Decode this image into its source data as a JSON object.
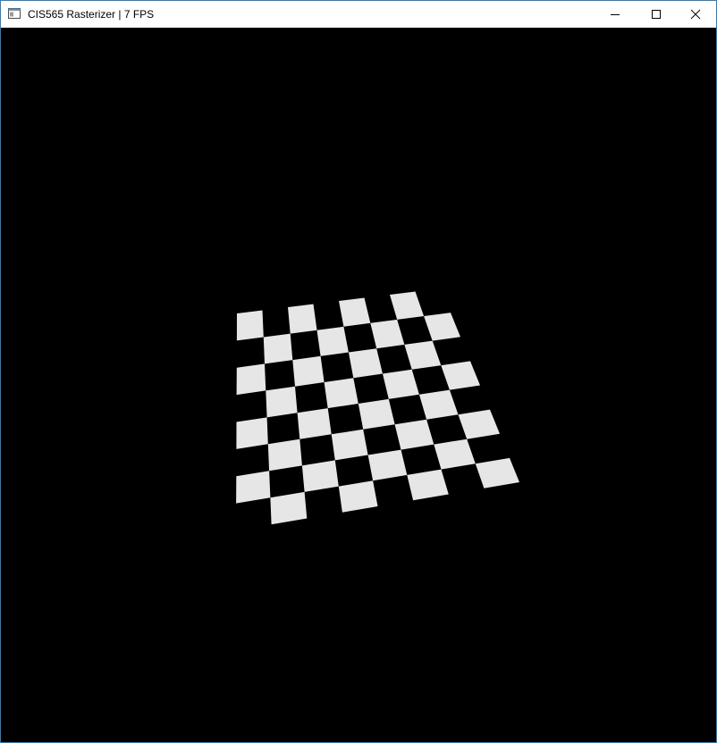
{
  "window": {
    "title": "CIS565 Rasterizer | 7 FPS",
    "icon": "app-window-icon",
    "controls": {
      "minimize": "minimize-icon",
      "maximize": "maximize-icon",
      "close": "close-icon"
    }
  },
  "scene": {
    "description_kind": "checkerboard-plane",
    "rows": 8,
    "cols": 8,
    "colors": {
      "background": "#000000",
      "light_tile": "#e6e6e6",
      "dark_tile": "#000000",
      "window_border": "#1883d7"
    }
  }
}
